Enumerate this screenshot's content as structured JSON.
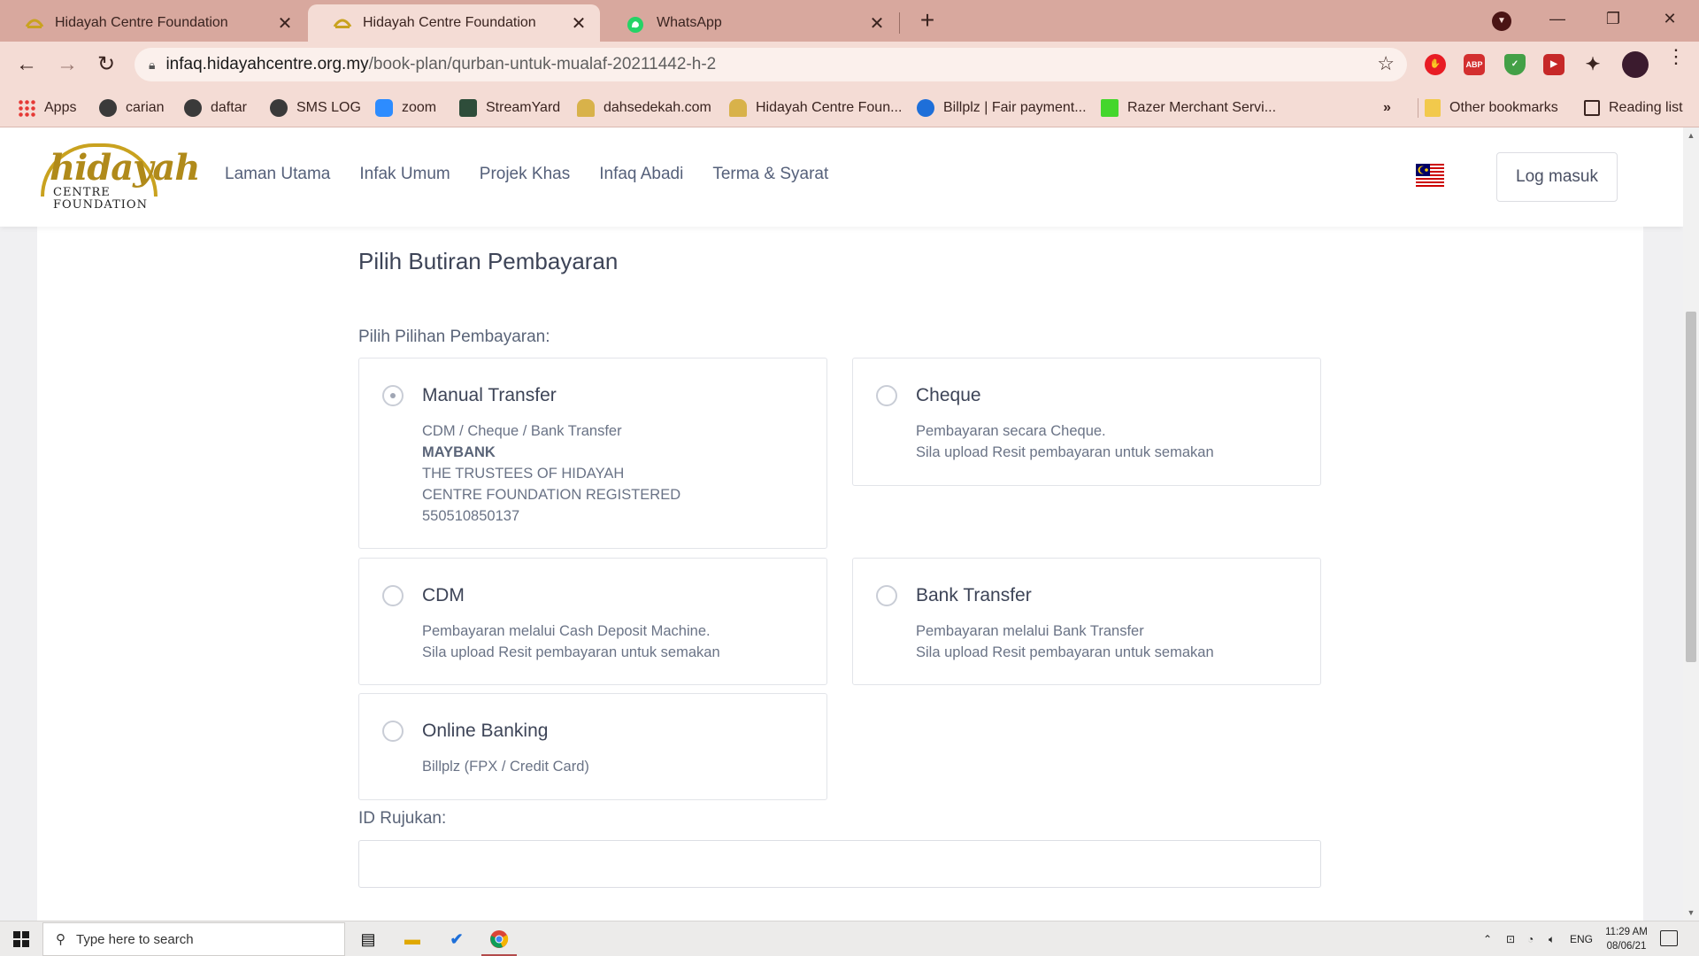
{
  "browser": {
    "tabs": [
      {
        "title": "Hidayah Centre Foundation",
        "active": false
      },
      {
        "title": "Hidayah Centre Foundation",
        "active": true
      },
      {
        "title": "WhatsApp",
        "active": false
      }
    ],
    "url_host": "infaq.hidayahcentre.org.my",
    "url_path": "/book-plan/qurban-untuk-mualaf-20211442-h-2",
    "extensions": [
      {
        "name": "adblock-icon",
        "label": "",
        "color": "#e81c24"
      },
      {
        "name": "abp-icon",
        "label": "ABP",
        "color": "#d32f2f"
      },
      {
        "name": "shield-icon",
        "label": "",
        "color": "#43a047"
      },
      {
        "name": "redirect-icon",
        "label": "",
        "color": "#c62828"
      },
      {
        "name": "puzzle-icon",
        "label": "",
        "color": "#3a2420"
      },
      {
        "name": "profile-avatar-icon",
        "label": "",
        "color": "#3b1b2e"
      }
    ],
    "bookmarks": [
      {
        "label": "Apps",
        "icon": "apps-grid-icon"
      },
      {
        "label": "carian",
        "icon": "globe-icon"
      },
      {
        "label": "daftar",
        "icon": "globe-icon"
      },
      {
        "label": "SMS LOG",
        "icon": "globe-icon"
      },
      {
        "label": "zoom",
        "icon": "zoom-icon"
      },
      {
        "label": "StreamYard",
        "icon": "streamyard-icon"
      },
      {
        "label": "dahsedekah.com",
        "icon": "dahsedekah-icon"
      },
      {
        "label": "Hidayah Centre Foun...",
        "icon": "hidayah-icon"
      },
      {
        "label": "Billplz | Fair payment...",
        "icon": "billplz-icon"
      },
      {
        "label": "Razer Merchant Servi...",
        "icon": "razer-icon"
      }
    ],
    "bookmarks_overflow": "»",
    "other_bookmarks": "Other bookmarks",
    "reading_list": "Reading list"
  },
  "site": {
    "logo": {
      "word": "hidayah",
      "line1": "CENTRE",
      "line2": "FOUNDATION"
    },
    "nav": [
      "Laman Utama",
      "Infak Umum",
      "Projek Khas",
      "Infaq Abadi",
      "Terma & Syarat"
    ],
    "login_label": "Log masuk"
  },
  "payment": {
    "section_title": "Pilih Butiran Pembayaran",
    "options_label": "Pilih Pilihan Pembayaran:",
    "options": [
      {
        "title": "Manual Transfer",
        "selected": true,
        "lines": [
          "CDM / Cheque / Bank Transfer"
        ],
        "bank": "MAYBANK",
        "account_lines": [
          "THE TRUSTEES OF HIDAYAH",
          "CENTRE FOUNDATION REGISTERED",
          "550510850137"
        ]
      },
      {
        "title": "Cheque",
        "selected": false,
        "lines": [
          "Pembayaran secara Cheque.",
          "Sila upload Resit pembayaran untuk semakan"
        ]
      },
      {
        "title": "CDM",
        "selected": false,
        "lines": [
          "Pembayaran melalui Cash Deposit Machine.",
          "Sila upload Resit pembayaran untuk semakan"
        ]
      },
      {
        "title": "Bank Transfer",
        "selected": false,
        "lines": [
          "Pembayaran melalui Bank Transfer",
          "Sila upload Resit pembayaran untuk semakan"
        ]
      },
      {
        "title": "Online Banking",
        "selected": false,
        "lines": [
          "Billplz (FPX / Credit Card)"
        ]
      }
    ],
    "reference_label": "ID Rujukan:",
    "reference_value": ""
  },
  "taskbar": {
    "search_placeholder": "Type here to search",
    "language": "ENG",
    "time": "11:29 AM",
    "date": "08/06/21"
  },
  "colors": {
    "tab_strip": "#d8a89e",
    "toolbar": "#f4dcd5",
    "logo_gold": "#b08a1a",
    "nav_text": "#55607a"
  }
}
